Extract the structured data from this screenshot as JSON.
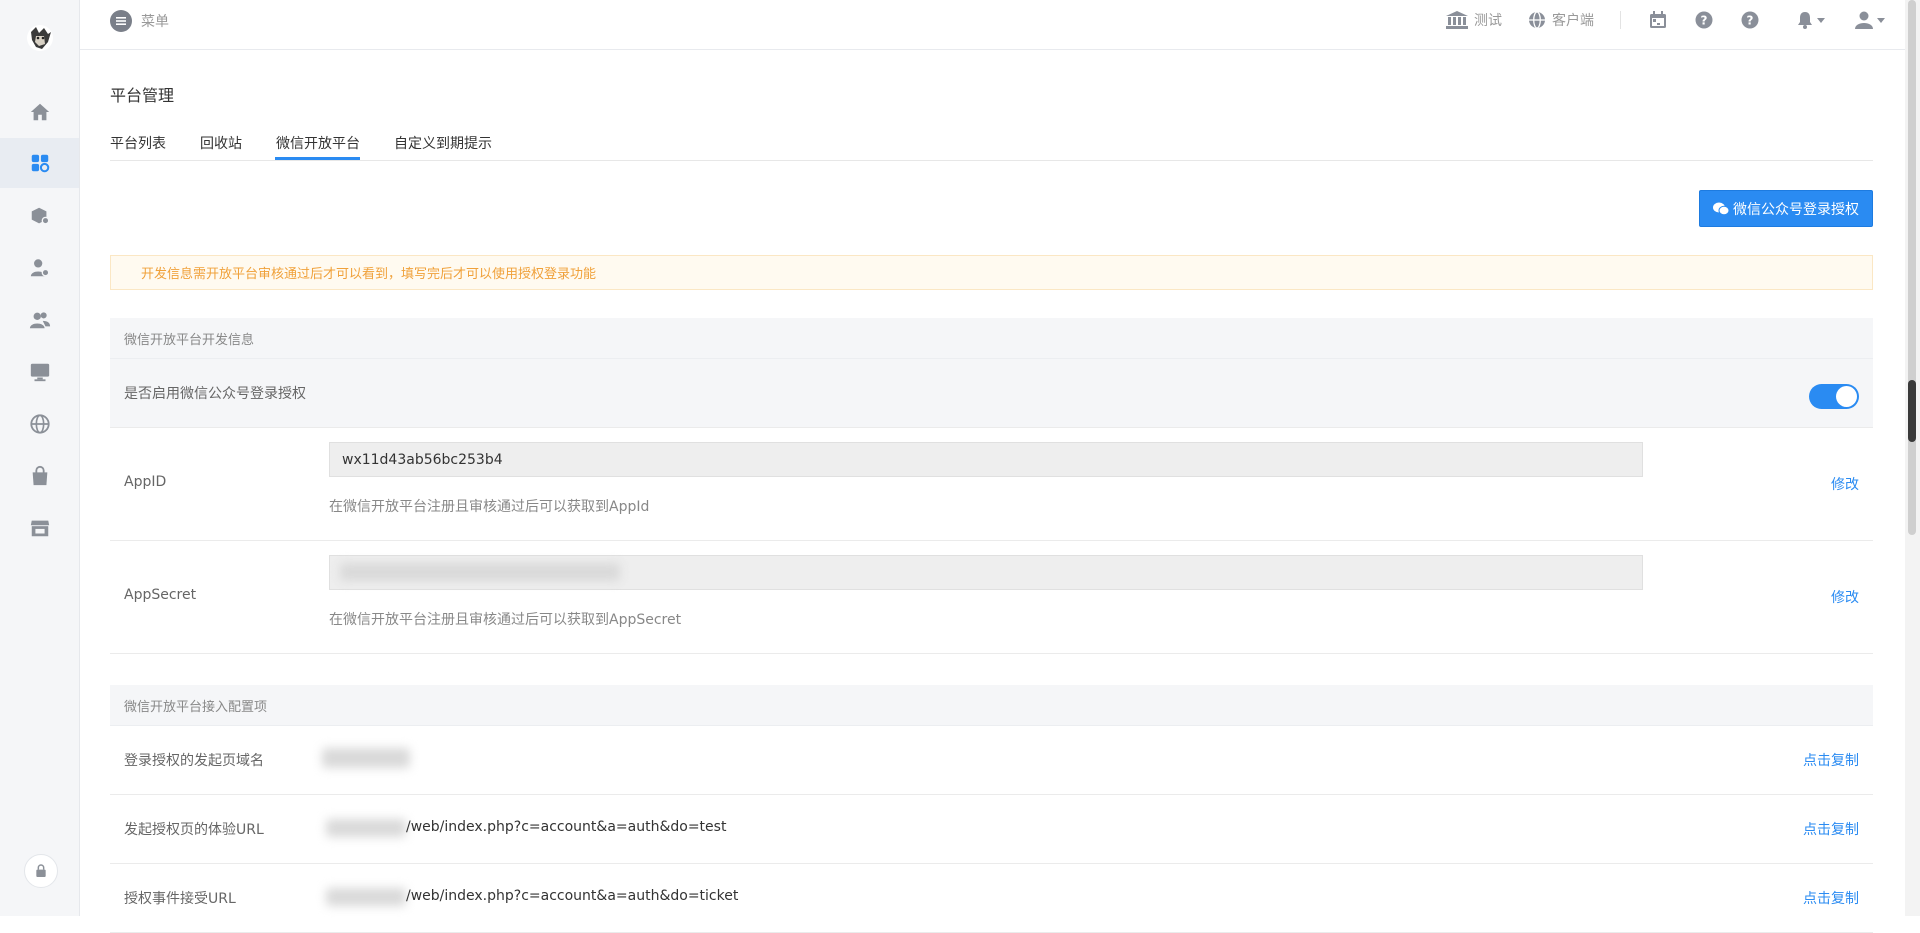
{
  "topbar": {
    "menu_label": "菜单",
    "links": [
      {
        "label": "测试",
        "icon": "bank-icon"
      },
      {
        "label": "客户端",
        "icon": "globe-icon"
      }
    ],
    "icons": [
      "calendar-icon",
      "help-icon",
      "help-icon",
      "bell-icon",
      "user-icon"
    ]
  },
  "sidebar": {
    "items": [
      "home-icon",
      "apps-icon",
      "box-icon",
      "user-settings-icon",
      "users-icon",
      "monitor-icon",
      "globe-icon",
      "bag-icon",
      "store-icon"
    ],
    "active_index": 1
  },
  "page": {
    "title": "平台管理",
    "tabs": [
      "平台列表",
      "回收站",
      "微信开放平台",
      "自定义到期提示"
    ],
    "active_tab": "微信开放平台",
    "auth_button": "微信公众号登录授权",
    "alert": "开发信息需开放平台审核通过后才可以看到，填写完后才可以使用授权登录功能"
  },
  "dev_info": {
    "header": "微信开放平台开发信息",
    "enable_label": "是否启用微信公众号登录授权",
    "enabled": true,
    "appid": {
      "label": "AppID",
      "value": "wx11d43ab56bc253b4",
      "help": "在微信开放平台注册且审核通过后可以获取到AppId",
      "action": "修改"
    },
    "appsecret": {
      "label": "AppSecret",
      "help": "在微信开放平台注册且审核通过后可以获取到AppSecret",
      "action": "修改"
    }
  },
  "config": {
    "header": "微信开放平台接入配置项",
    "rows": [
      {
        "label": "登录授权的发起页域名",
        "value": "",
        "action": "点击复制"
      },
      {
        "label": "发起授权页的体验URL",
        "value": "/web/index.php?c=account&a=auth&do=test",
        "action": "点击复制"
      },
      {
        "label": "授权事件接受URL",
        "value": "/web/index.php?c=account&a=auth&do=ticket",
        "action": "点击复制"
      }
    ]
  },
  "colors": {
    "accent": "#2a8bf2",
    "alert_text": "#f0a13a",
    "sidebar_bg": "#f5f6f8"
  }
}
